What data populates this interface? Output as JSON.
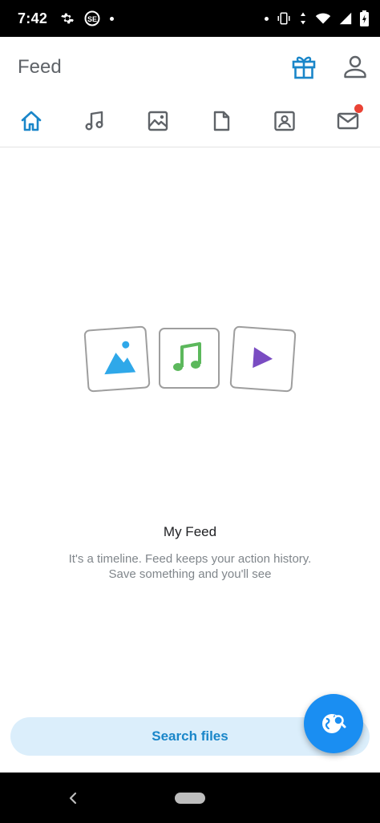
{
  "status_bar": {
    "time": "7:42",
    "icons": [
      "settings-icon",
      "se-app-icon",
      "notification-dot",
      "vibrate-icon",
      "data-arrows-icon",
      "wifi-icon",
      "signal-icon",
      "battery-icon"
    ]
  },
  "app_bar": {
    "title": "Feed",
    "gift_icon": "gift-icon",
    "profile_icon": "person-icon"
  },
  "tabs": [
    {
      "name": "home",
      "icon": "home-icon",
      "active": true
    },
    {
      "name": "music",
      "icon": "music-note-icon",
      "active": false
    },
    {
      "name": "images",
      "icon": "image-icon",
      "active": false
    },
    {
      "name": "documents",
      "icon": "document-icon",
      "active": false
    },
    {
      "name": "contacts",
      "icon": "contact-card-icon",
      "active": false
    },
    {
      "name": "mail",
      "icon": "mail-icon",
      "active": false,
      "has_badge": true
    }
  ],
  "empty_state": {
    "title": "My Feed",
    "line1": "It's a timeline. Feed keeps your action history.",
    "line2": "Save something and you'll see"
  },
  "search": {
    "label": "Search files"
  },
  "fab": {
    "icon": "globe-search-icon"
  },
  "colors": {
    "accent": "#1a8ef2",
    "active_tab": "#1a86c9",
    "inactive_icon": "#5f6368",
    "search_bg": "#dbeefb",
    "badge": "#ea4335",
    "image_blue": "#2fa8e9",
    "music_green": "#5cb85c",
    "video_purple": "#7a4cc2"
  }
}
